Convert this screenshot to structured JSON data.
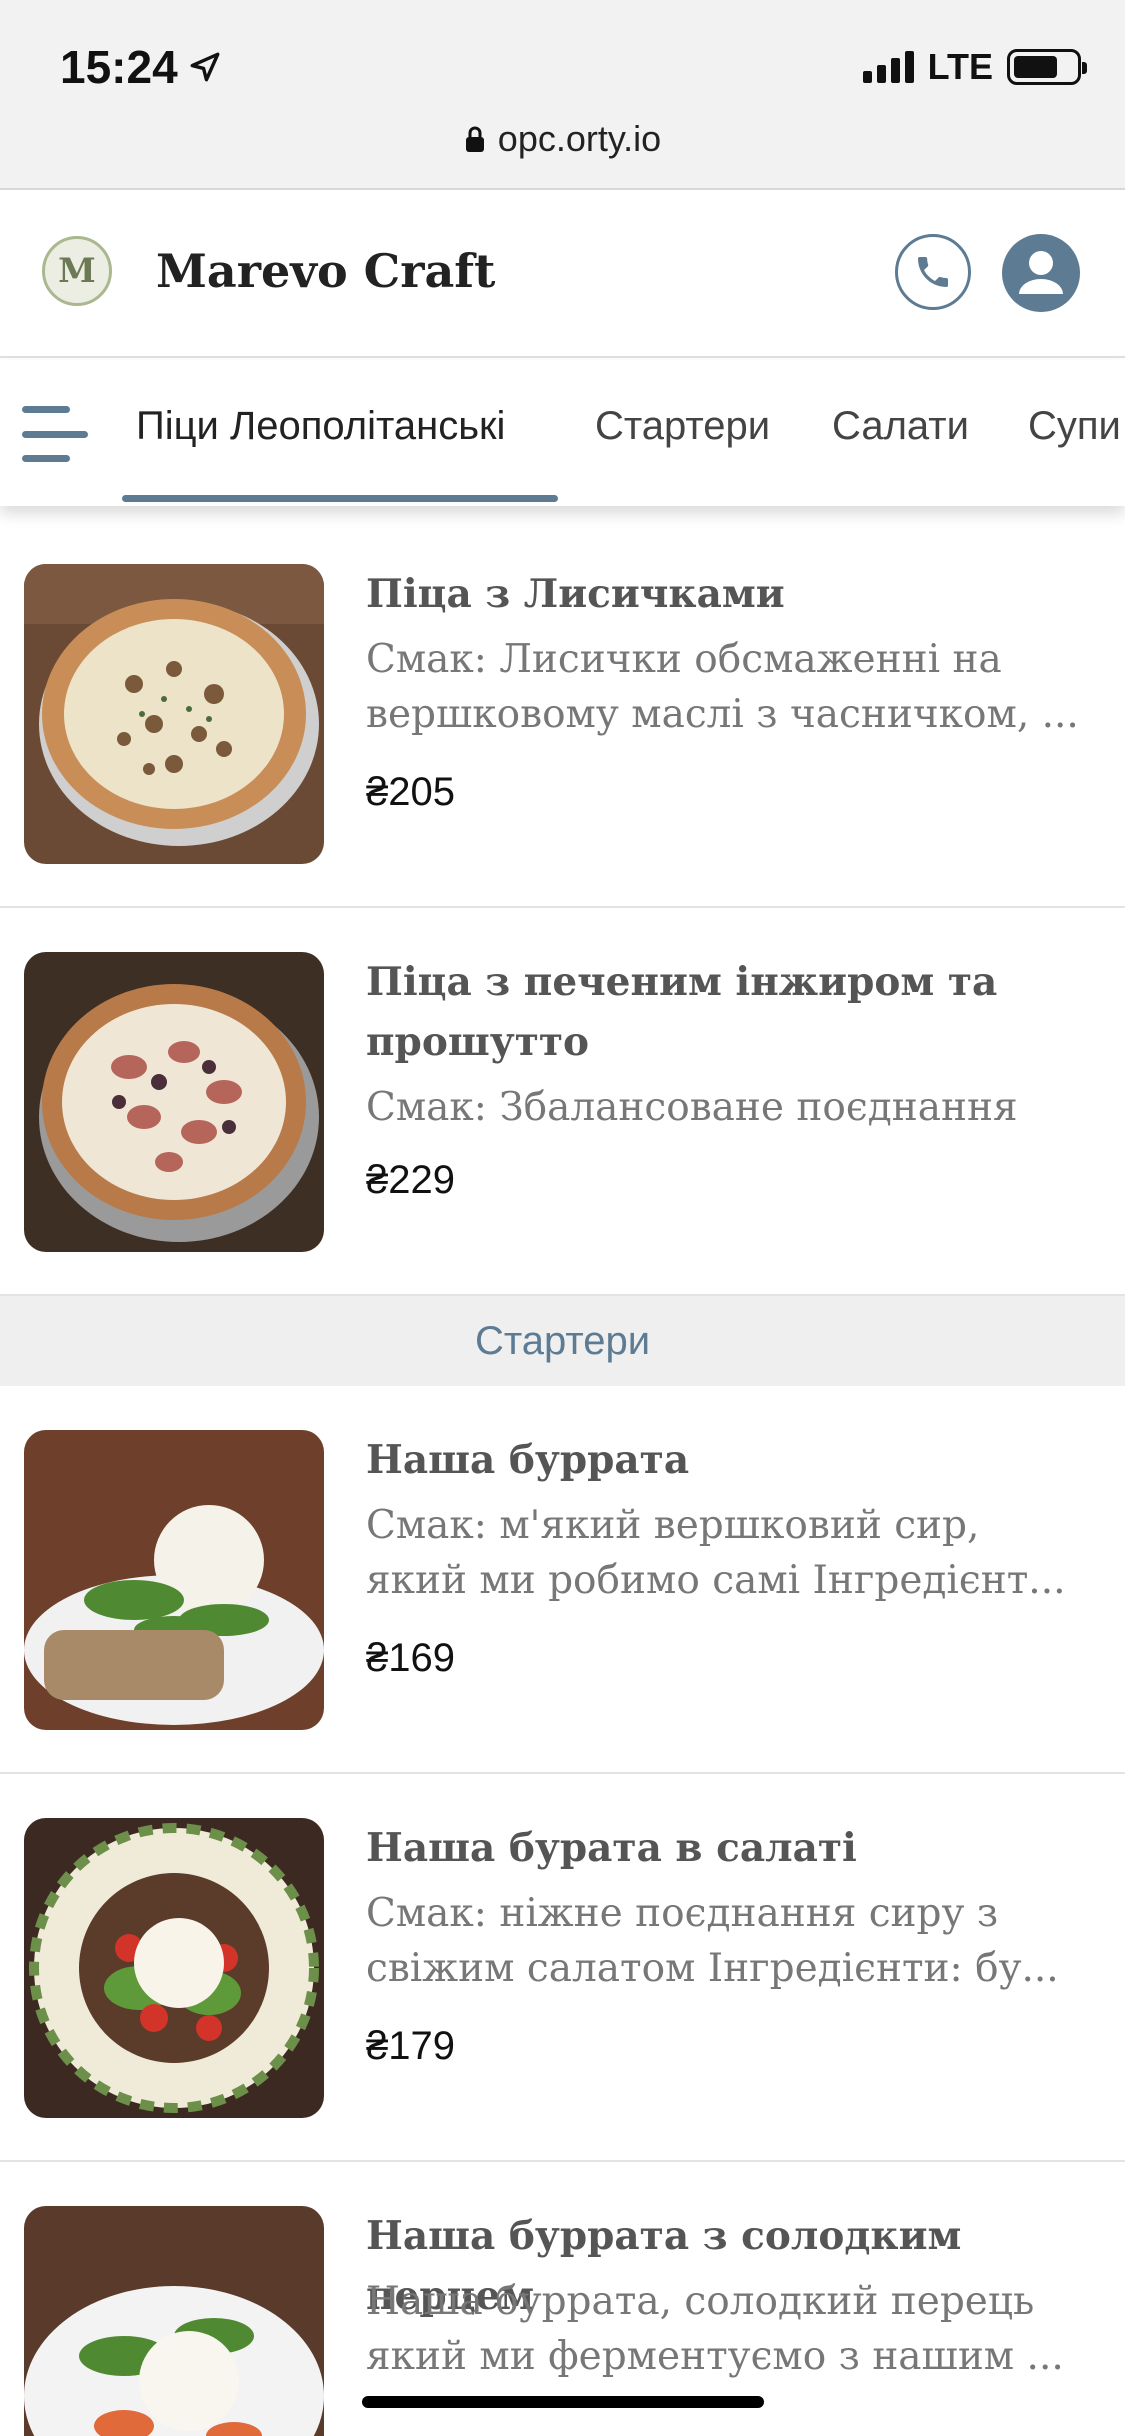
{
  "status_bar": {
    "time": "15:24",
    "network": "LTE",
    "url": "opc.orty.io"
  },
  "header": {
    "brand": "Marevo Craft",
    "logo_letter": "M"
  },
  "nav": {
    "tabs": [
      {
        "label": "Піци Леополітанські",
        "active": true
      },
      {
        "label": "Стартери"
      },
      {
        "label": "Салати"
      },
      {
        "label": "Супи"
      }
    ]
  },
  "items": [
    {
      "name": "Піца з Лисичками",
      "description": "Смак: Лисички обсмаженні на вершковому маслі з часничком, ...",
      "price": "₴205",
      "image": "pizza-chanterelle"
    },
    {
      "name": "Піца з печеним інжиром та прошутто",
      "description": "Смак: Збалансоване поєднання",
      "price": "₴229",
      "image": "pizza-fig-prosciutto"
    },
    {
      "name": "Наша буррата",
      "description": "Смак: м'який вершковий сир, який ми робимо самі Інгредієнт...",
      "price": "₴169",
      "image": "burrata-arugula"
    },
    {
      "name": "Наша бурата в салаті",
      "description": "Смак: ніжне поєднання сиру з свіжим салатом Інгредієнти: бу...",
      "price": "₴179",
      "image": "burrata-salad"
    },
    {
      "name": "Наша буррата з солодким перцем",
      "description": "Наша буррата, солодкий перець який ми ферментуємо з нашим ...",
      "price": "",
      "image": "burrata-pepper"
    }
  ],
  "section_header": "Стартери",
  "colors": {
    "accent": "#5d7b93",
    "divider": "#e3e3e3",
    "section_bg": "#efefef"
  }
}
